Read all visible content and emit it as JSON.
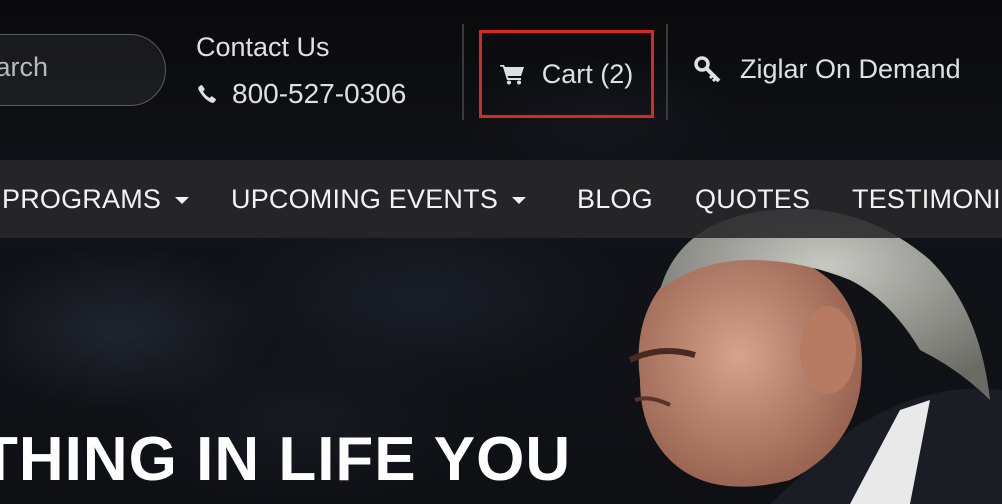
{
  "header": {
    "search": {
      "placeholder": "Search"
    },
    "contact": {
      "title": "Contact Us",
      "phone": "800-527-0306"
    },
    "cart": {
      "label": "Cart (2)"
    },
    "on_demand": {
      "label": "Ziglar On Demand"
    }
  },
  "nav": {
    "items": [
      {
        "label": "PROGRAMS",
        "has_dropdown": true
      },
      {
        "label": "UPCOMING EVENTS",
        "has_dropdown": true
      },
      {
        "label": "BLOG",
        "has_dropdown": false
      },
      {
        "label": "QUOTES",
        "has_dropdown": false
      },
      {
        "label": "TESTIMONI",
        "has_dropdown": false
      }
    ]
  },
  "hero": {
    "headline": "THING IN LIFE YOU"
  },
  "colors": {
    "cart_highlight": "#d62a20",
    "nav_bg": "#28282a",
    "text": "#e0e0e0"
  },
  "icons": [
    "phone-icon",
    "cart-icon",
    "key-icon",
    "caret-down-icon"
  ]
}
